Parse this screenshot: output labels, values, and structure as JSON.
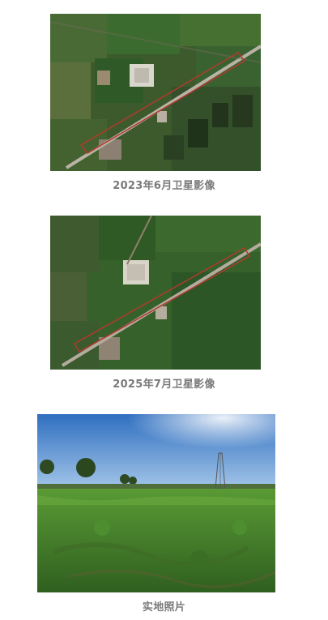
{
  "figures": [
    {
      "caption": "2023年6月卫星影像",
      "image": "satellite-image-2023"
    },
    {
      "caption": "2025年7月卫星影像",
      "image": "satellite-image-2025"
    },
    {
      "caption": "实地照片",
      "image": "field-photo"
    }
  ],
  "colors": {
    "caption": "#7a7a7a",
    "boundary": "#b03a2e",
    "sky": "#3f7fc9",
    "field": "#4d8a2c"
  }
}
